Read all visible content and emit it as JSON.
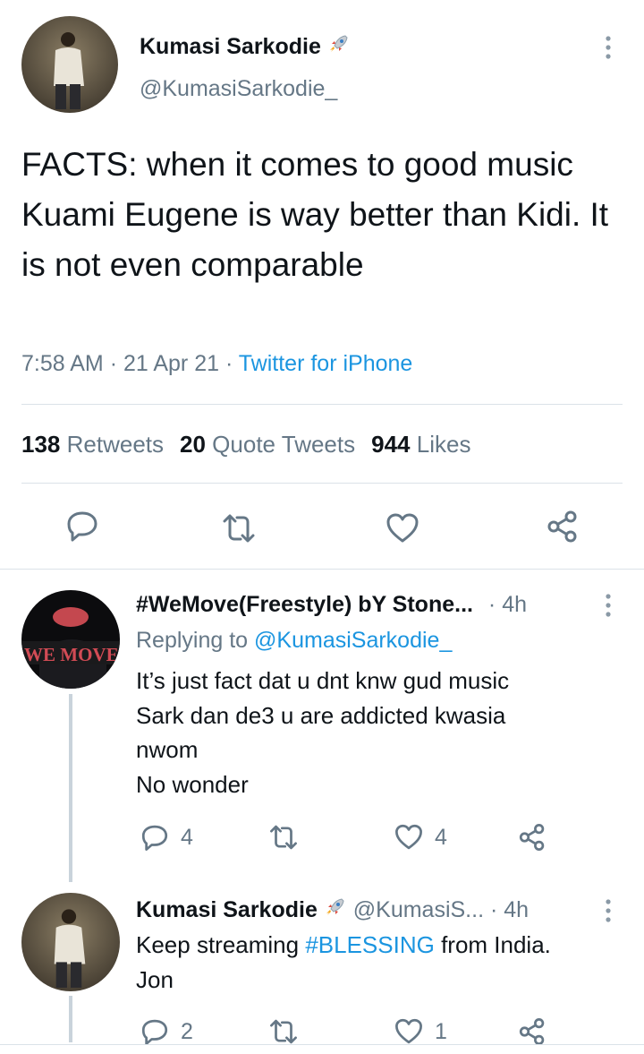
{
  "main_tweet": {
    "display_name": "Kumasi Sarkodie",
    "handle": "@KumasiSarkodie_",
    "name_emoji": "rocket-icon",
    "text": "FACTS: when it comes to good music Kuami Eugene is way better than Kidi. It is not even comparable",
    "time": "7:58 AM",
    "date": "21 Apr 21",
    "source": "Twitter for iPhone",
    "separator": "·",
    "stats": {
      "retweets_count": "138",
      "retweets_label": "Retweets",
      "quotes_count": "20",
      "quotes_label": "Quote Tweets",
      "likes_count": "944",
      "likes_label": "Likes"
    },
    "actions": [
      "reply-icon",
      "retweet-icon",
      "like-icon",
      "share-icon"
    ]
  },
  "replies": [
    {
      "display_name": "#WeMove(Freestyle) bY Stone...",
      "time": "4h",
      "separator": "·",
      "replying_prefix": "Replying to",
      "replying_handle": "@KumasiSarkodie_",
      "text": "It’s just fact dat u dnt knw gud music\nSark dan de3 u are addicted kwasia\nnwom\nNo wonder",
      "avatar_text": "WE MOVE",
      "reply_count": "4",
      "retweet_count": "",
      "like_count": "4"
    },
    {
      "display_name": "Kumasi Sarkodie",
      "handle": "@KumasiS...",
      "time": "4h",
      "separator": "·",
      "text_before": "Keep streaming ",
      "hashtag": "#BLESSING",
      "text_after": " from India.\nJon",
      "reply_count": "2",
      "retweet_count": "",
      "like_count": "1"
    }
  ],
  "colors": {
    "accent": "#1b95e0",
    "muted": "#657786",
    "text": "#0f1419",
    "divider": "#dbe2e8"
  }
}
